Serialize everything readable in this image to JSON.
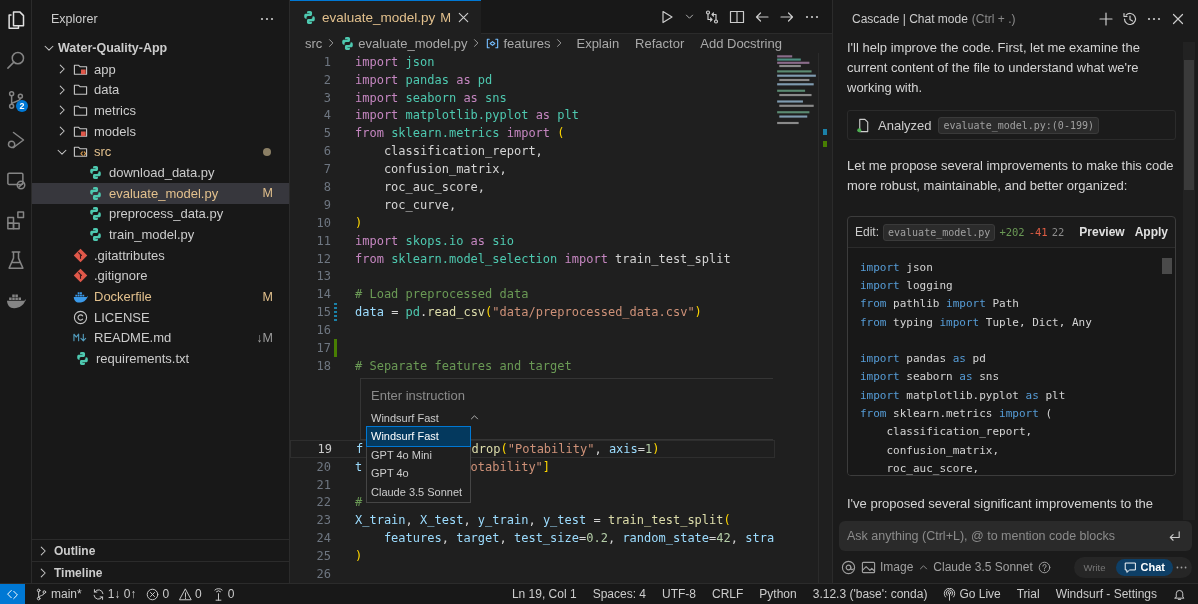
{
  "activity_bar": {
    "items": [
      {
        "kind": "explorer",
        "selected": true
      },
      {
        "kind": "search",
        "selected": false
      },
      {
        "kind": "scm",
        "selected": false,
        "badge": "2"
      },
      {
        "kind": "debug",
        "selected": false
      },
      {
        "kind": "remote",
        "selected": false
      },
      {
        "kind": "extensions",
        "selected": false
      },
      {
        "kind": "testing",
        "selected": false
      },
      {
        "kind": "docker",
        "selected": false
      }
    ]
  },
  "sidebar": {
    "title": "Explorer",
    "tree": [
      {
        "name": "Water-Quality-App",
        "kind": "project",
        "expanded": true,
        "selected": false,
        "children": [
          {
            "name": "app",
            "kind": "folder-badge",
            "expanded": false,
            "selected": false
          },
          {
            "name": "data",
            "kind": "folder",
            "expanded": false,
            "selected": false
          },
          {
            "name": "metrics",
            "kind": "folder",
            "expanded": false,
            "selected": false
          },
          {
            "name": "models",
            "kind": "folder-badge",
            "expanded": false,
            "selected": false
          },
          {
            "name": "src",
            "kind": "folder-code",
            "expanded": true,
            "selected": false,
            "modified": true,
            "dot": true,
            "children": [
              {
                "name": "download_data.py",
                "kind": "python",
                "selected": false
              },
              {
                "name": "evaluate_model.py",
                "kind": "python",
                "selected": true,
                "modified": true,
                "status": "M"
              },
              {
                "name": "preprocess_data.py",
                "kind": "python",
                "selected": false
              },
              {
                "name": "train_model.py",
                "kind": "python",
                "selected": false
              }
            ]
          },
          {
            "name": ".gitattributes",
            "kind": "git",
            "selected": false
          },
          {
            "name": ".gitignore",
            "kind": "git",
            "selected": false
          },
          {
            "name": "Dockerfile",
            "kind": "docker",
            "selected": false,
            "modified": true,
            "status": "M"
          },
          {
            "name": "LICENSE",
            "kind": "license",
            "selected": false
          },
          {
            "name": "README.md",
            "kind": "markdown",
            "selected": false,
            "status": "↓M"
          },
          {
            "name": "requirements.txt",
            "kind": "python",
            "selected": false
          }
        ]
      }
    ],
    "sections": [
      {
        "title": "Outline",
        "expanded": false
      },
      {
        "title": "Timeline",
        "expanded": false
      }
    ]
  },
  "editor": {
    "tab": {
      "label": "evaluate_model.py",
      "status": "M"
    },
    "breadcrumbs": [
      {
        "text": "src",
        "kind": "folder"
      },
      {
        "text": "evaluate_model.py",
        "kind": "python"
      },
      {
        "text": "features",
        "kind": "variable"
      }
    ],
    "actions": [
      "Explain",
      "Refactor",
      "Add Docstring"
    ],
    "lines_before_prompt": [
      {
        "number": "1",
        "current": false,
        "tokens": [
          {
            "kind": "keyword",
            "text": "import"
          },
          {
            "kind": "module",
            "text": " json"
          }
        ]
      },
      {
        "number": "2",
        "current": false,
        "tokens": [
          {
            "kind": "keyword",
            "text": "import"
          },
          {
            "kind": "module",
            "text": " pandas"
          },
          {
            "kind": "keyword",
            "text": " as"
          },
          {
            "kind": "module",
            "text": " pd"
          }
        ]
      },
      {
        "number": "3",
        "current": false,
        "tokens": [
          {
            "kind": "keyword",
            "text": "import"
          },
          {
            "kind": "module",
            "text": " seaborn"
          },
          {
            "kind": "keyword",
            "text": " as"
          },
          {
            "kind": "module",
            "text": " sns"
          }
        ]
      },
      {
        "number": "4",
        "current": false,
        "tokens": [
          {
            "kind": "keyword",
            "text": "import"
          },
          {
            "kind": "module",
            "text": " matplotlib.pyplot"
          },
          {
            "kind": "keyword",
            "text": " as"
          },
          {
            "kind": "module",
            "text": " plt"
          }
        ]
      },
      {
        "number": "5",
        "current": false,
        "tokens": [
          {
            "kind": "keyword",
            "text": "from"
          },
          {
            "kind": "module",
            "text": " sklearn.metrics"
          },
          {
            "kind": "keyword",
            "text": " import"
          },
          {
            "kind": "bracket",
            "text": " ("
          }
        ]
      },
      {
        "number": "6",
        "current": false,
        "tokens": [
          {
            "kind": "plain",
            "text": "    classification_report,"
          }
        ]
      },
      {
        "number": "7",
        "current": false,
        "tokens": [
          {
            "kind": "plain",
            "text": "    confusion_matrix,"
          }
        ]
      },
      {
        "number": "8",
        "current": false,
        "tokens": [
          {
            "kind": "plain",
            "text": "    roc_auc_score,"
          }
        ]
      },
      {
        "number": "9",
        "current": false,
        "tokens": [
          {
            "kind": "plain",
            "text": "    roc_curve,"
          }
        ]
      },
      {
        "number": "10",
        "current": false,
        "tokens": [
          {
            "kind": "bracket",
            "text": ")"
          }
        ]
      },
      {
        "number": "11",
        "current": false,
        "tokens": [
          {
            "kind": "keyword",
            "text": "import"
          },
          {
            "kind": "module",
            "text": " skops.io"
          },
          {
            "kind": "keyword",
            "text": " as"
          },
          {
            "kind": "module",
            "text": " sio"
          }
        ]
      },
      {
        "number": "12",
        "current": false,
        "tokens": [
          {
            "kind": "keyword",
            "text": "from"
          },
          {
            "kind": "module",
            "text": " sklearn.model_selection"
          },
          {
            "kind": "keyword",
            "text": " import"
          },
          {
            "kind": "plain",
            "text": " train_test_split"
          }
        ]
      },
      {
        "number": "13",
        "current": false
      },
      {
        "number": "14",
        "current": false,
        "tokens": [
          {
            "kind": "comment",
            "text": "# Load preprocessed data"
          }
        ]
      },
      {
        "number": "15",
        "current": false,
        "modified": true,
        "tokens": [
          {
            "kind": "variable",
            "text": "data"
          },
          {
            "kind": "plain",
            "text": " = "
          },
          {
            "kind": "module",
            "text": "pd"
          },
          {
            "kind": "plain",
            "text": "."
          },
          {
            "kind": "function",
            "text": "read_csv"
          },
          {
            "kind": "bracket",
            "text": "("
          },
          {
            "kind": "string",
            "text": "\"data/preprocessed_data.csv\""
          },
          {
            "kind": "bracket",
            "text": ")"
          }
        ]
      },
      {
        "number": "16",
        "current": false
      },
      {
        "number": "17",
        "current": false,
        "added": true
      },
      {
        "number": "18",
        "current": false,
        "tokens": [
          {
            "kind": "comment",
            "text": "# Separate features and target"
          }
        ]
      }
    ],
    "prompt": {
      "placeholder": "Enter instruction",
      "model": "Windsurf Fast",
      "models": [
        {
          "label": "Windsurf Fast",
          "selected": true
        },
        {
          "label": "GPT 4o Mini",
          "selected": false
        },
        {
          "label": "GPT 4o",
          "selected": false
        },
        {
          "label": "Claude 3.5 Sonnet",
          "selected": false
        }
      ]
    },
    "lines_after_prompt": [
      {
        "number": "19",
        "current": true,
        "tokens": [
          {
            "kind": "variable",
            "text": "f"
          }
        ],
        "tail": [
          {
            "kind": "function",
            "text": "drop"
          },
          {
            "kind": "bracket",
            "text": "("
          },
          {
            "kind": "string",
            "text": "\"Potability\""
          },
          {
            "kind": "plain",
            "text": ", "
          },
          {
            "kind": "variable",
            "text": "axis"
          },
          {
            "kind": "plain",
            "text": "="
          },
          {
            "kind": "number",
            "text": "1"
          },
          {
            "kind": "bracket",
            "text": ")"
          }
        ]
      },
      {
        "number": "20",
        "current": false,
        "tokens": [
          {
            "kind": "variable",
            "text": "t"
          }
        ],
        "tail": [
          {
            "kind": "string",
            "text": "otability\""
          },
          {
            "kind": "bracket",
            "text": "]"
          }
        ]
      },
      {
        "number": "21",
        "current": false
      },
      {
        "number": "22",
        "current": false,
        "tokens": [
          {
            "kind": "comment",
            "text": "#"
          }
        ]
      },
      {
        "number": "23",
        "current": false,
        "tokens": [
          {
            "kind": "variable",
            "text": "X_train"
          },
          {
            "kind": "plain",
            "text": ", "
          },
          {
            "kind": "variable",
            "text": "X_test"
          },
          {
            "kind": "plain",
            "text": ", "
          },
          {
            "kind": "variable",
            "text": "y_train"
          },
          {
            "kind": "plain",
            "text": ", "
          },
          {
            "kind": "variable",
            "text": "y_test"
          },
          {
            "kind": "plain",
            "text": " = "
          },
          {
            "kind": "function",
            "text": "train_test_split"
          },
          {
            "kind": "bracket",
            "text": "("
          }
        ]
      },
      {
        "number": "24",
        "current": false,
        "tokens": [
          {
            "kind": "variable",
            "text": "    features"
          },
          {
            "kind": "plain",
            "text": ", "
          },
          {
            "kind": "variable",
            "text": "target"
          },
          {
            "kind": "plain",
            "text": ", "
          },
          {
            "kind": "variable",
            "text": "test_size"
          },
          {
            "kind": "plain",
            "text": "="
          },
          {
            "kind": "number",
            "text": "0.2"
          },
          {
            "kind": "plain",
            "text": ", "
          },
          {
            "kind": "variable",
            "text": "random_state"
          },
          {
            "kind": "plain",
            "text": "="
          },
          {
            "kind": "number",
            "text": "42"
          },
          {
            "kind": "plain",
            "text": ", "
          },
          {
            "kind": "variable",
            "text": "stra"
          }
        ]
      },
      {
        "number": "25",
        "current": false,
        "tokens": [
          {
            "kind": "bracket",
            "text": ")"
          }
        ]
      },
      {
        "number": "26",
        "current": false
      }
    ]
  },
  "chat": {
    "title": "Cascade | Chat mode",
    "shortcut": "(Ctrl + .)",
    "messages": [
      {
        "kind": "text",
        "text": "I'll help improve the code. First, let me examine the current content of the file to understand what we're working with."
      },
      {
        "kind": "tool",
        "label": "Analyzed",
        "file": "evaluate_model.py:(0-199)"
      },
      {
        "kind": "text",
        "text": "Let me propose several improvements to make this code more robust, maintainable, and better organized:"
      },
      {
        "kind": "edit",
        "label": "Edit:",
        "file": "evaluate_model.py",
        "added": "+202",
        "removed": "-41",
        "count": "22",
        "actions": [
          "Preview",
          "Apply"
        ],
        "lines": [
          {
            "tokens": [
              {
                "kind": "keyword",
                "text": "import"
              },
              {
                "kind": "plain",
                "text": " json"
              }
            ]
          },
          {
            "tokens": [
              {
                "kind": "keyword",
                "text": "import"
              },
              {
                "kind": "plain",
                "text": " logging"
              }
            ]
          },
          {
            "tokens": [
              {
                "kind": "keyword",
                "text": "from"
              },
              {
                "kind": "plain",
                "text": " pathlib "
              },
              {
                "kind": "keyword",
                "text": "import"
              },
              {
                "kind": "plain",
                "text": " Path"
              }
            ]
          },
          {
            "tokens": [
              {
                "kind": "keyword",
                "text": "from"
              },
              {
                "kind": "plain",
                "text": " typing "
              },
              {
                "kind": "keyword",
                "text": "import"
              },
              {
                "kind": "plain",
                "text": " Tuple, Dict, Any"
              }
            ]
          },
          {
            "gap_before": true,
            "tokens": [
              {
                "kind": "keyword",
                "text": "import"
              },
              {
                "kind": "plain",
                "text": " pandas "
              },
              {
                "kind": "keyword",
                "text": "as"
              },
              {
                "kind": "plain",
                "text": " pd"
              }
            ]
          },
          {
            "tokens": [
              {
                "kind": "keyword",
                "text": "import"
              },
              {
                "kind": "plain",
                "text": " seaborn "
              },
              {
                "kind": "keyword",
                "text": "as"
              },
              {
                "kind": "plain",
                "text": " sns"
              }
            ]
          },
          {
            "tokens": [
              {
                "kind": "keyword",
                "text": "import"
              },
              {
                "kind": "plain",
                "text": " matplotlib.pyplot "
              },
              {
                "kind": "keyword",
                "text": "as"
              },
              {
                "kind": "plain",
                "text": " plt"
              }
            ]
          },
          {
            "tokens": [
              {
                "kind": "keyword",
                "text": "from"
              },
              {
                "kind": "plain",
                "text": " sklearn.metrics "
              },
              {
                "kind": "keyword",
                "text": "import"
              },
              {
                "kind": "plain",
                "text": " ("
              }
            ]
          },
          {
            "tokens": [
              {
                "kind": "plain",
                "text": "    classification_report,"
              }
            ]
          },
          {
            "tokens": [
              {
                "kind": "plain",
                "text": "    confusion_matrix,"
              }
            ]
          },
          {
            "tokens": [
              {
                "kind": "plain",
                "text": "    roc_auc_score,"
              }
            ]
          }
        ]
      },
      {
        "kind": "text",
        "text": "I've proposed several significant improvements to the"
      }
    ],
    "input": {
      "placeholder": "Ask anything (Ctrl+L), @ to mention code blocks"
    },
    "toolbar": {
      "image": "Image",
      "model": "Claude 3.5 Sonnet",
      "modes": [
        {
          "label": "Write",
          "selected": false
        },
        {
          "label": "Chat",
          "selected": true
        }
      ]
    }
  },
  "status_bar": {
    "left": [
      {
        "kind": "remote"
      },
      {
        "kind": "branch",
        "text": "main*"
      },
      {
        "kind": "sync",
        "text": "1↓ 0↑"
      },
      {
        "kind": "errors",
        "text": "0"
      },
      {
        "kind": "warnings",
        "text": "0"
      },
      {
        "kind": "ports",
        "text": "0"
      }
    ],
    "right": [
      {
        "kind": "text",
        "text": "Ln 19, Col 1"
      },
      {
        "kind": "text",
        "text": "Spaces: 4"
      },
      {
        "kind": "text",
        "text": "UTF-8"
      },
      {
        "kind": "text",
        "text": "CRLF"
      },
      {
        "kind": "text",
        "text": "Python"
      },
      {
        "kind": "text",
        "text": "3.12.3 ('base': conda)"
      },
      {
        "kind": "live",
        "text": "Go Live"
      },
      {
        "kind": "text",
        "text": "Trial"
      },
      {
        "kind": "text",
        "text": "Windsurf - Settings"
      },
      {
        "kind": "bell"
      }
    ]
  }
}
